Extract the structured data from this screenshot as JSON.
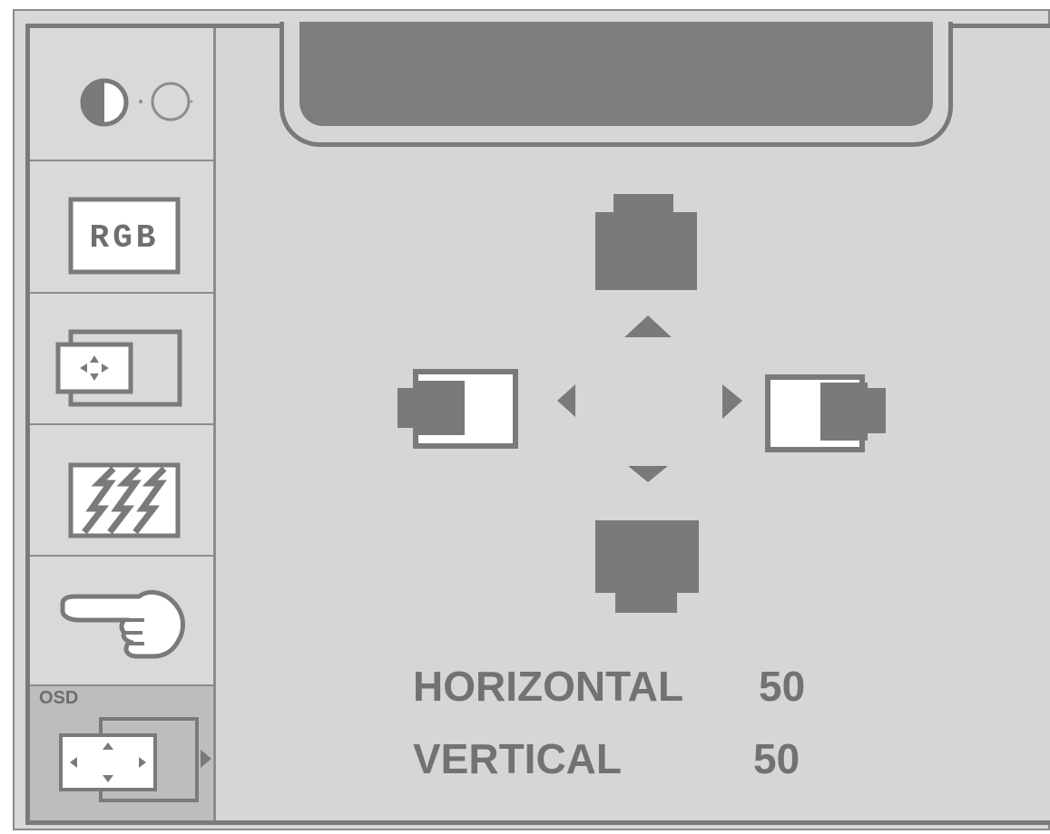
{
  "sidebar": {
    "items": [
      {
        "name": "brightness-contrast",
        "icon": "brightness-contrast-icon"
      },
      {
        "name": "rgb",
        "icon": "rgb-icon",
        "label": "RGB"
      },
      {
        "name": "position",
        "icon": "screen-position-icon"
      },
      {
        "name": "image-adjust",
        "icon": "image-adjust-icon"
      },
      {
        "name": "select",
        "icon": "pointing-hand-icon"
      },
      {
        "name": "osd-position",
        "icon": "osd-position-icon",
        "label": "OSD",
        "selected": true
      }
    ]
  },
  "title_bar": {
    "text": ""
  },
  "readouts": {
    "horizontal_label": "HORIZONTAL",
    "horizontal_value": "50",
    "vertical_label": "VERTICAL",
    "vertical_value": "50"
  },
  "colors": {
    "panel": "#d8d8d8",
    "icon_dark": "#7a7a7a",
    "selected_item": "#bdbdbd",
    "text": "#727272"
  }
}
